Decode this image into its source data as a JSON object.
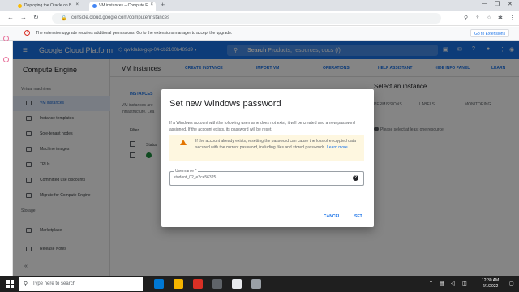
{
  "browser": {
    "tabs": [
      {
        "label": "Deploying the Oracle on B...",
        "active": false
      },
      {
        "label": "VM instances – Compute E...",
        "active": true
      }
    ],
    "url": "console.cloud.google.com/compute/instances",
    "infobar": {
      "message": "The extension upgrade requires additional permissions. Go to the extensions manager to accept the upgrade.",
      "button": "Go to Extensions"
    }
  },
  "header": {
    "brand": "Google Cloud Platform",
    "project": "qwiklabs-gcp-04-cb2100b489d9",
    "search_label": "Search",
    "search_placeholder": "Products, resources, docs (/)"
  },
  "sidebar": {
    "title": "Compute Engine",
    "sections": [
      "Virtual machines",
      "Storage"
    ],
    "items": [
      {
        "label": "VM instances",
        "active": true
      },
      {
        "label": "Instance templates"
      },
      {
        "label": "Sole-tenant nodes"
      },
      {
        "label": "Machine images"
      },
      {
        "label": "TPUs"
      },
      {
        "label": "Committed use discounts"
      },
      {
        "label": "Migrate for Compute Engine"
      },
      {
        "label": "Marketplace"
      },
      {
        "label": "Release Notes"
      }
    ]
  },
  "main": {
    "title": "VM instances",
    "actions": [
      "CREATE INSTANCE",
      "IMPORT VM",
      "OPERATIONS",
      "HELP ASSISTANT",
      "HIDE INFO PANEL",
      "LEARN"
    ],
    "instances_tab": "INSTANCES",
    "partial_text": [
      "VM instances are",
      "infrastructure. Lea"
    ],
    "filter": "Filter",
    "status_col": "Status"
  },
  "info_panel": {
    "title": "Select an instance",
    "tabs": [
      "PERMISSIONS",
      "LABELS",
      "MONITORING"
    ],
    "message": "Please select at least one resource."
  },
  "dialog": {
    "title": "Set new Windows password",
    "description": "If a Windows account with the following username does not exist, it will be created and a new password assigned. If the account exists, its password will be reset.",
    "warning": "If the account already exists, resetting the password can cause the loss of encrypted data secured with the current password, including files and stored passwords.",
    "warning_link": "Learn more",
    "username_label": "Username *",
    "username_value": "student_02_e2ce56325",
    "cancel": "CANCEL",
    "set": "SET"
  },
  "taskbar": {
    "search_placeholder": "Type here to search",
    "time": "12:30 AM",
    "date": "2/1/2022"
  },
  "colors": {
    "accent": "#1a73e8",
    "warning": "#e37400"
  }
}
